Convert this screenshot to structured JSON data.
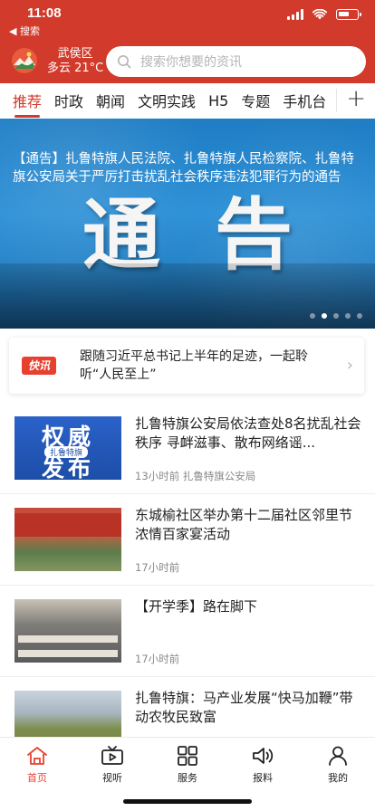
{
  "status": {
    "time": "11:08",
    "back_label": "◀ 搜索"
  },
  "header": {
    "district": "武侯区",
    "weather": "多云 21°C",
    "search_placeholder": "搜索你想要的资讯"
  },
  "tabs": [
    {
      "label": "推荐"
    },
    {
      "label": "时政"
    },
    {
      "label": "朝闻"
    },
    {
      "label": "文明实践"
    },
    {
      "label": "H5"
    },
    {
      "label": "专题"
    },
    {
      "label": "手机台"
    }
  ],
  "banner": {
    "image_text": "通告",
    "caption": "【通告】扎鲁特旗人民法院、扎鲁特旗人民检察院、扎鲁特旗公安局关于严厉打击扰乱社会秩序违法犯罪行为的通告",
    "dot_count": 5,
    "active_dot": 1
  },
  "flash": {
    "tag": "快讯",
    "text": "跟随习近平总书记上半年的足迹，一起聆听“人民至上”"
  },
  "news": [
    {
      "title": "扎鲁特旗公安局依法查处8名扰乱社会秩序 寻衅滋事、散布网络谣...",
      "meta": "13小时前 扎鲁特旗公安局",
      "thumb_text": {
        "line1": "权威",
        "badge": "扎鲁特旗",
        "line2": "发布"
      }
    },
    {
      "title": "东城榆社区举办第十二届社区邻里节浓情百家宴活动",
      "meta": "17小时前"
    },
    {
      "title": "【开学季】路在脚下",
      "meta": "17小时前"
    },
    {
      "title": "扎鲁特旗：马产业发展“快马加鞭”带动农牧民致富",
      "meta": ""
    }
  ],
  "bottom_nav": [
    {
      "label": "首页",
      "icon": "home-icon",
      "active": true
    },
    {
      "label": "视听",
      "icon": "video-icon"
    },
    {
      "label": "服务",
      "icon": "grid-icon"
    },
    {
      "label": "报料",
      "icon": "speaker-icon"
    },
    {
      "label": "我的",
      "icon": "user-icon"
    }
  ],
  "colors": {
    "brand_red": "#d23a2b",
    "flash_red": "#e8402f"
  }
}
